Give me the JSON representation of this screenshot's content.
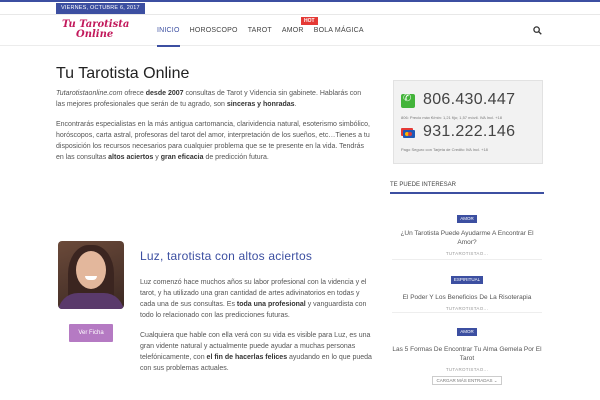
{
  "topbar": {
    "date": "VIERNES, OCTUBRE 6, 2017"
  },
  "header": {
    "logo_line1": "Tu Tarotista",
    "logo_line2": "Online",
    "nav": [
      {
        "label": "INICIO",
        "active": true
      },
      {
        "label": "HOROSCOPO",
        "active": false
      },
      {
        "label": "TAROT",
        "active": false
      },
      {
        "label": "AMOR",
        "active": false
      },
      {
        "label": "BOLA MÁGICA",
        "active": false
      }
    ],
    "hot_badge": "HOT",
    "search_icon": "search-icon"
  },
  "main": {
    "title": "Tu Tarotista Online",
    "intro_p1_site": "Tutarotistaonline.com",
    "intro_p1_a": " ofrece ",
    "intro_p1_b": "desde 2007",
    "intro_p1_c": " consultas de Tarot y Videncia sin gabinete. Hablarás con las mejores profesionales que serán de tu agrado, son ",
    "intro_p1_d": "sinceras y honradas",
    "intro_p1_e": ".",
    "intro_p2_a": "Encontrarás especialistas en la más antigua cartomancia, clarividencia natural, esoterismo simbólico, horóscopos, carta astral, profesoras del tarot del amor, interpretación de los sueños, etc…Tienes a tu disposición los recursos necesarios para cualquier problema que se te presente en la vida. Tendrás en las consultas ",
    "intro_p2_b": "altos aciertos",
    "intro_p2_c": " y ",
    "intro_p2_d": "gran eficacia",
    "intro_p2_e": " de predicción futura."
  },
  "tarotista": {
    "name": "Luz, tarotista con altos aciertos",
    "button": "Ver Ficha",
    "p1_a": "Luz comenzó hace muchos años su labor profesional con la videncia y el tarot, y ha utilizado una gran cantidad de artes adivinatorios en todas y cada una de sus consultas. Es ",
    "p1_b": "toda una profesional",
    "p1_c": " y vanguardista con todo lo relacionado con las predicciones futuras.",
    "p2_a": "Cualquiera que hable con ella verá con su vida es visible para Luz, es una gran vidente natural y actualmente puede ayudar a muchas personas telefónicamente, con ",
    "p2_b": "el fin de hacerlas felices",
    "p2_c": " ayudando en lo que pueda con sus problemas actuales."
  },
  "sidebar": {
    "phone1": "806.430.447",
    "phone1_note": "806: Precio máx €/min: 1,21 fijo; 1,57 móvil. IVA Incl. +18",
    "phone2": "931.222.146",
    "phone2_note": "Pago Seguro con Tarjeta de Credito IVA Incl. +18",
    "section_title": "TE PUEDE INTERESAR",
    "items": [
      {
        "tag": "AMOR",
        "title": "¿Un Tarotista Puede Ayudarme A Encontrar El Amor?",
        "meta": "TUTAROTISTAO..."
      },
      {
        "tag": "ESPIRITUAL",
        "title": "El Poder Y Los Beneficios De La Risoterapia",
        "meta": "TUTAROTISTAO..."
      },
      {
        "tag": "AMOR",
        "title": "Las 5 Formas De Encontrar Tu Alma Gemela Por El Tarot",
        "meta": "TUTAROTISTAO..."
      }
    ],
    "load_more": "CARGAR MÁS ENTRADAS ⌄"
  }
}
